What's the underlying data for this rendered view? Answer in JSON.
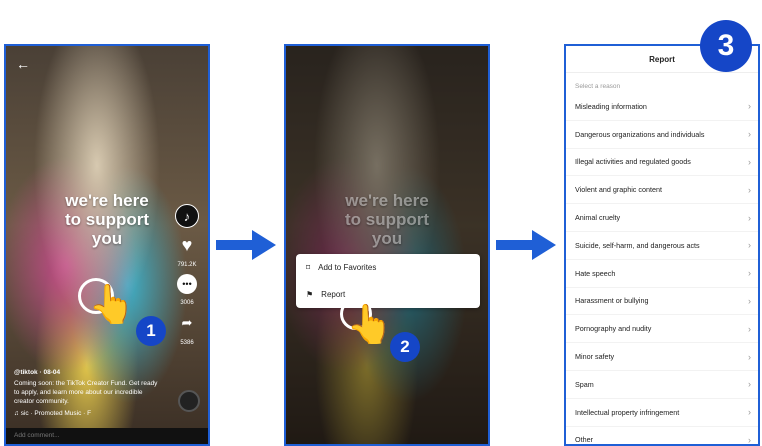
{
  "panel1": {
    "back_icon": "back-arrow-icon",
    "overlay_text": [
      "we're here",
      "to support",
      "you"
    ],
    "likes": "791.2K",
    "comments": "3006",
    "shares": "5386",
    "username": "@tiktok",
    "date": "08-04",
    "caption": "Coming soon: the TikTok Creator Fund. Get ready to apply, and learn more about our incredible creator community.",
    "music": "sic · Promoted Music · F",
    "add_comment": "Add comment...",
    "step_number": "1"
  },
  "panel2": {
    "overlay_text": [
      "we're here",
      "to support",
      "you"
    ],
    "menu_items": [
      {
        "label": "Add to Favorites",
        "icon": "bookmark-icon"
      },
      {
        "label": "Report",
        "icon": "flag-icon"
      }
    ],
    "step_number": "2"
  },
  "panel3": {
    "title": "Report",
    "subtitle": "Select a reason",
    "reasons": [
      "Misleading information",
      "Dangerous organizations and individuals",
      "Illegal activities and regulated goods",
      "Violent and graphic content",
      "Animal cruelty",
      "Suicide, self-harm, and dangerous acts",
      "Hate speech",
      "Harassment or bullying",
      "Pornography and nudity",
      "Minor safety",
      "Spam",
      "Intellectual property infringement",
      "Other"
    ],
    "step_number": "3"
  },
  "colors": {
    "accent": "#1546c7",
    "border": "#1f5fd6"
  }
}
